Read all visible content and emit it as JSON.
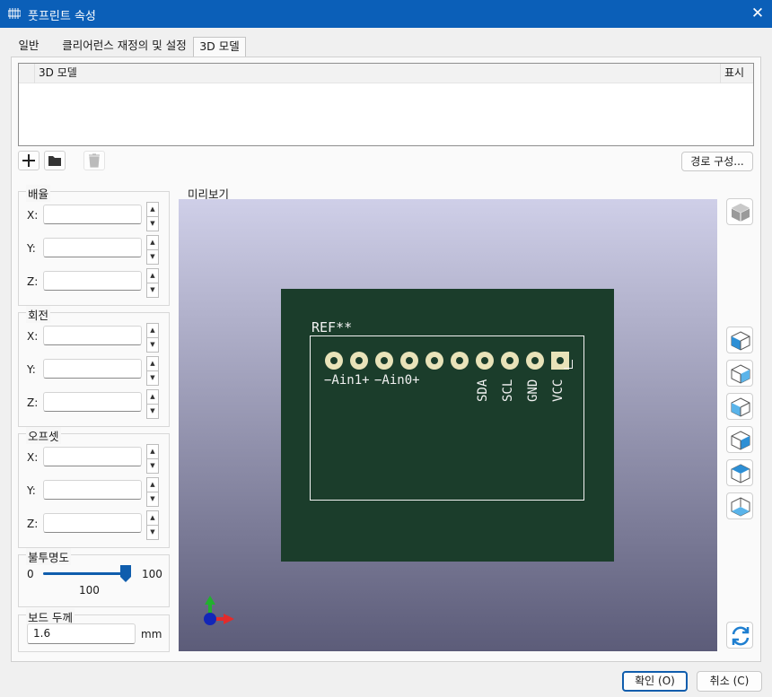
{
  "window": {
    "title": "풋프린트 속성",
    "close_glyph": "✕"
  },
  "tabs": [
    {
      "label": "일반",
      "active": false
    },
    {
      "label": "클리어런스 재정의 및 설정",
      "active": false
    },
    {
      "label": "3D 모델",
      "active": true
    }
  ],
  "model_table": {
    "col_model": "3D 모델",
    "col_show": "표시",
    "rows": []
  },
  "toolbar": {
    "path_config": "경로 구성..."
  },
  "scale": {
    "title": "배율",
    "x_label": "X:",
    "y_label": "Y:",
    "z_label": "Z:"
  },
  "rotation": {
    "title": "회전",
    "x_label": "X:",
    "y_label": "Y:",
    "z_label": "Z:"
  },
  "offset": {
    "title": "오프셋",
    "x_label": "X:",
    "y_label": "Y:",
    "z_label": "Z:"
  },
  "opacity": {
    "title": "불투명도",
    "min": "0",
    "max": "100",
    "value": "100",
    "value_fraction": 1.0
  },
  "board_thickness": {
    "title": "보드 두께",
    "value": "1.6",
    "unit": "mm"
  },
  "preview": {
    "title": "미리보기",
    "pcb": {
      "ref": "REF**",
      "bottom_labels": [
        "−Ain1+",
        "−Ain0+"
      ],
      "pin_labels": [
        "SDA",
        "SCL",
        "GND",
        "VCC"
      ]
    }
  },
  "footer": {
    "ok": "확인 (O)",
    "cancel": "취소 (C)"
  },
  "colors": {
    "accent": "#0b5fb8",
    "pcb": "#1b3d2b",
    "pad": "#e9e3b9",
    "axis_x": "#e32b2b",
    "axis_y": "#22b02e",
    "axis_z": "#1326b8"
  }
}
